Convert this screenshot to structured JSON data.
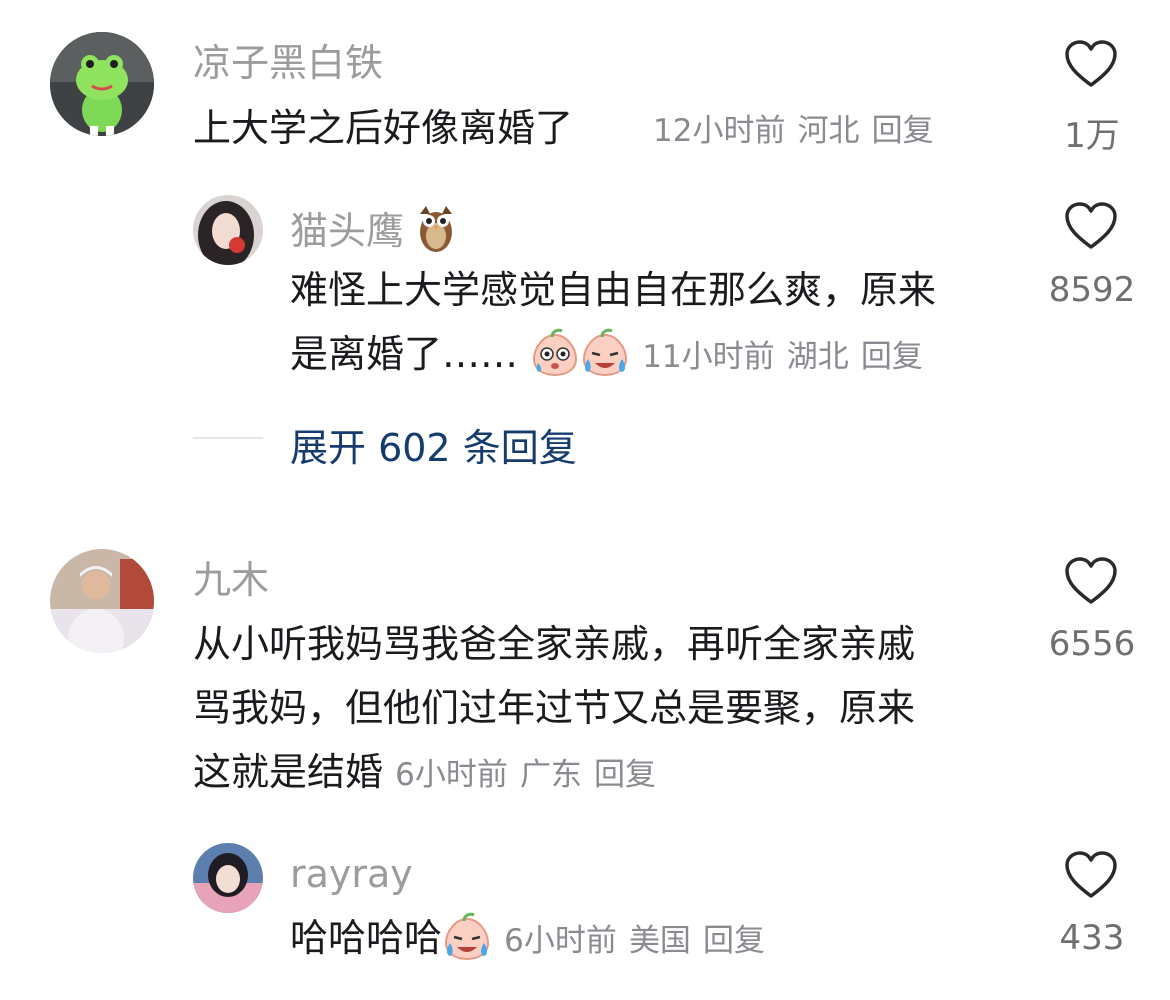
{
  "comments": [
    {
      "username": "凉子黑白铁",
      "text": "上大学之后好像离婚了",
      "time": "12小时前",
      "region": "河北",
      "reply_label": "回复",
      "likes": "1万",
      "replies": [
        {
          "username": "猫头鹰",
          "line1": "难怪上大学感觉自由自在那么爽，原来",
          "line2": "是离婚了……",
          "time": "11小时前",
          "region": "湖北",
          "reply_label": "回复",
          "likes": "8592"
        }
      ],
      "expand_label": "展开 602 条回复"
    },
    {
      "username": "九木",
      "line1": "从小听我妈骂我爸全家亲戚，再听全家亲戚",
      "line2": "骂我妈，但他们过年过节又总是要聚，原来",
      "line3": "这就是结婚",
      "time": "6小时前",
      "region": "广东",
      "reply_label": "回复",
      "likes": "6556",
      "replies": [
        {
          "username": "rayray",
          "text": "哈哈哈哈",
          "time": "6小时前",
          "region": "美国",
          "reply_label": "回复",
          "likes": "433"
        }
      ]
    }
  ],
  "icons": {
    "like": "heart-outline-icon",
    "owl": "owl-emoji",
    "sweat": "sweat-peach-emoji",
    "cry": "crying-peach-emoji"
  },
  "colors": {
    "username": "#9c9c9f",
    "meta": "#8a8b91",
    "expand": "#163c6e"
  }
}
